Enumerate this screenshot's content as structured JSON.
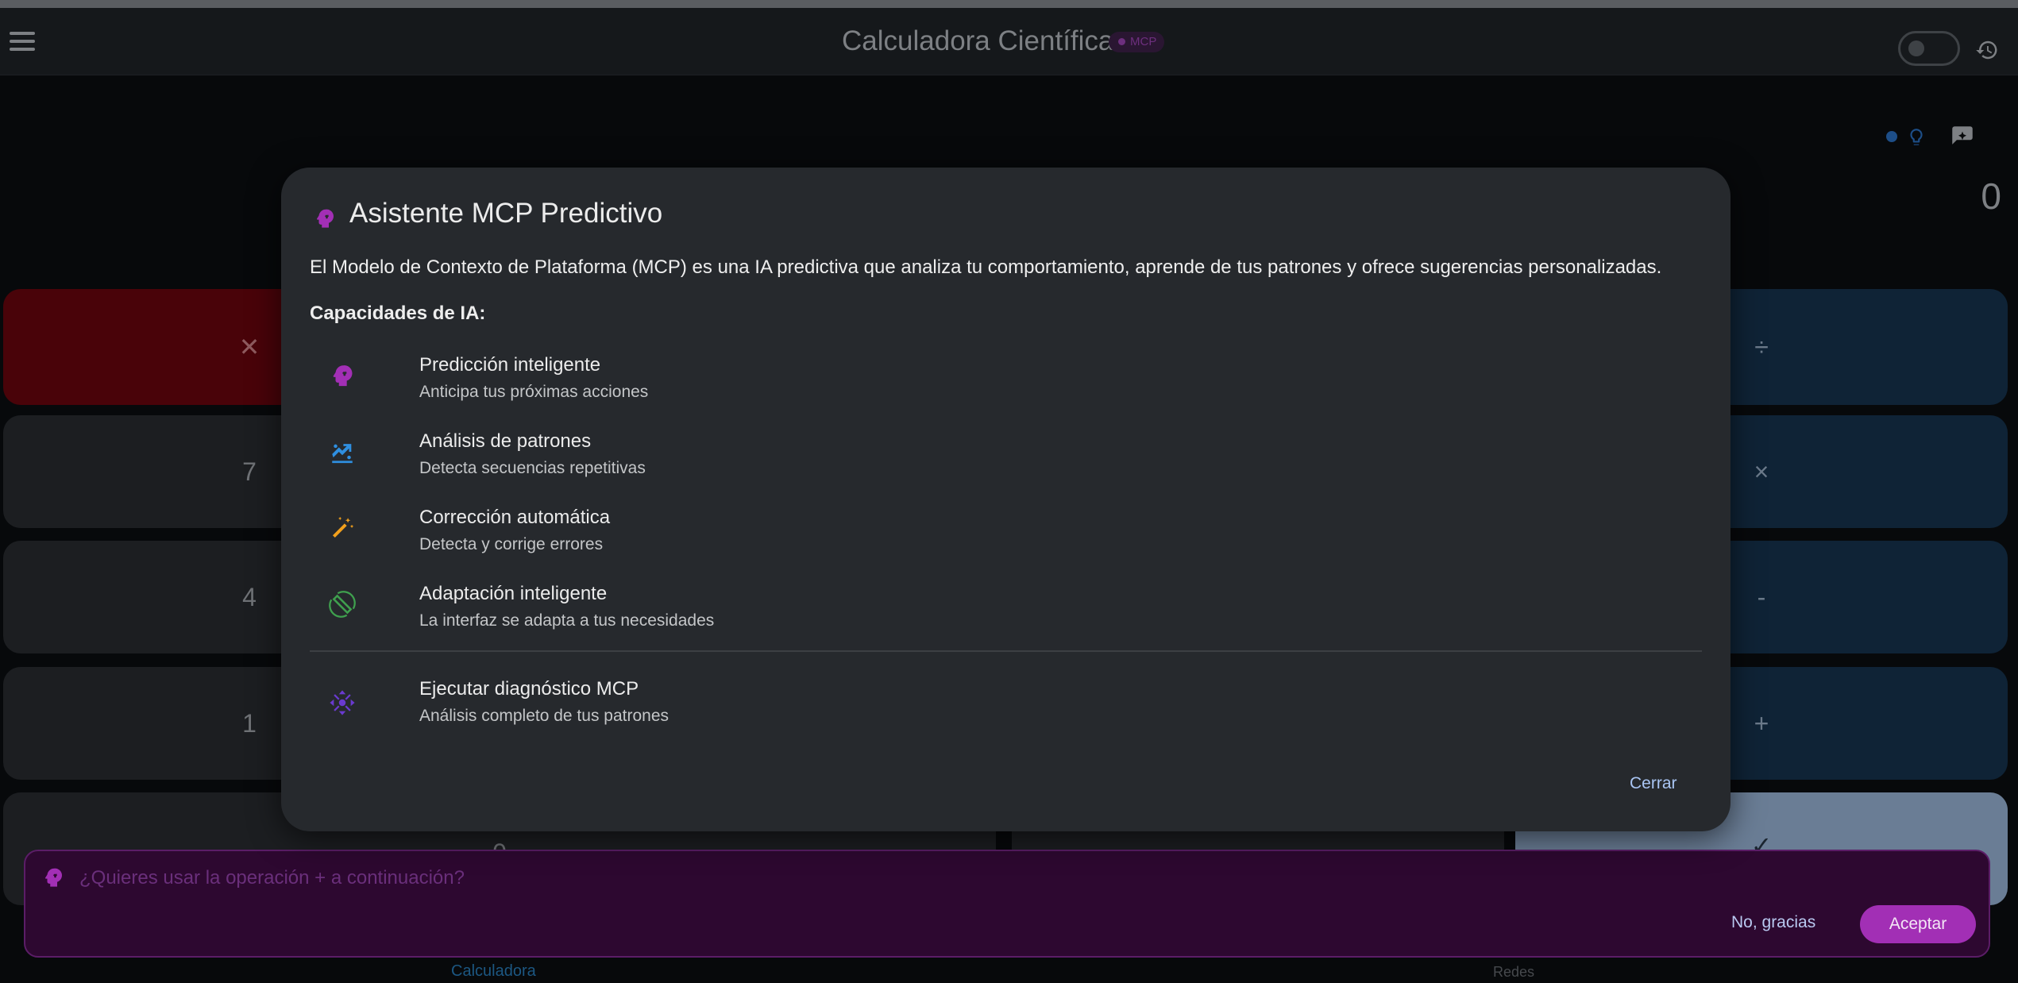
{
  "app": {
    "title": "Calculadora Científica",
    "mcp_chip": "MCP",
    "display_value": "0"
  },
  "keypad": {
    "clear": "✕",
    "seven": "7",
    "four": "4",
    "one": "1",
    "zero": "0",
    "divide": "÷",
    "multiply": "×",
    "minus": "-",
    "plus": "+",
    "equals": "✓"
  },
  "nav": {
    "calculator": "Calculadora",
    "networks": "Redes"
  },
  "suggestion": {
    "text": "¿Quieres usar la operación + a continuación?",
    "decline": "No, gracias",
    "accept": "Aceptar"
  },
  "dialog": {
    "title": "Asistente MCP Predictivo",
    "description": "El Modelo de Contexto de Plataforma (MCP) es una IA predictiva que analiza tu comportamiento, aprende de tus patrones y ofrece sugerencias personalizadas.",
    "capabilities_heading": "Capacidades de IA:",
    "items": [
      {
        "title": "Predicción inteligente",
        "subtitle": "Anticipa tus próximas acciones",
        "icon": "psychology-icon"
      },
      {
        "title": "Análisis de patrones",
        "subtitle": "Detecta secuencias repetitivas",
        "icon": "pattern-analysis-icon"
      },
      {
        "title": "Corrección automática",
        "subtitle": "Detecta y corrige errores",
        "icon": "magic-wand-icon"
      },
      {
        "title": "Adaptación inteligente",
        "subtitle": "La interfaz se adapta a tus necesidades",
        "icon": "screen-rotation-icon"
      }
    ],
    "diagnostic": {
      "title": "Ejecutar diagnóstico MCP",
      "subtitle": "Análisis completo de tus patrones",
      "icon": "hub-icon"
    },
    "close": "Cerrar"
  },
  "colors": {
    "accent_purple": "#a22fb5",
    "pattern_blue": "#2f8fe0",
    "wand_orange": "#f2a01c",
    "adapt_green": "#3fa04e",
    "diagnostic_purple": "#6a3ad0",
    "clear_red": "#490309"
  }
}
